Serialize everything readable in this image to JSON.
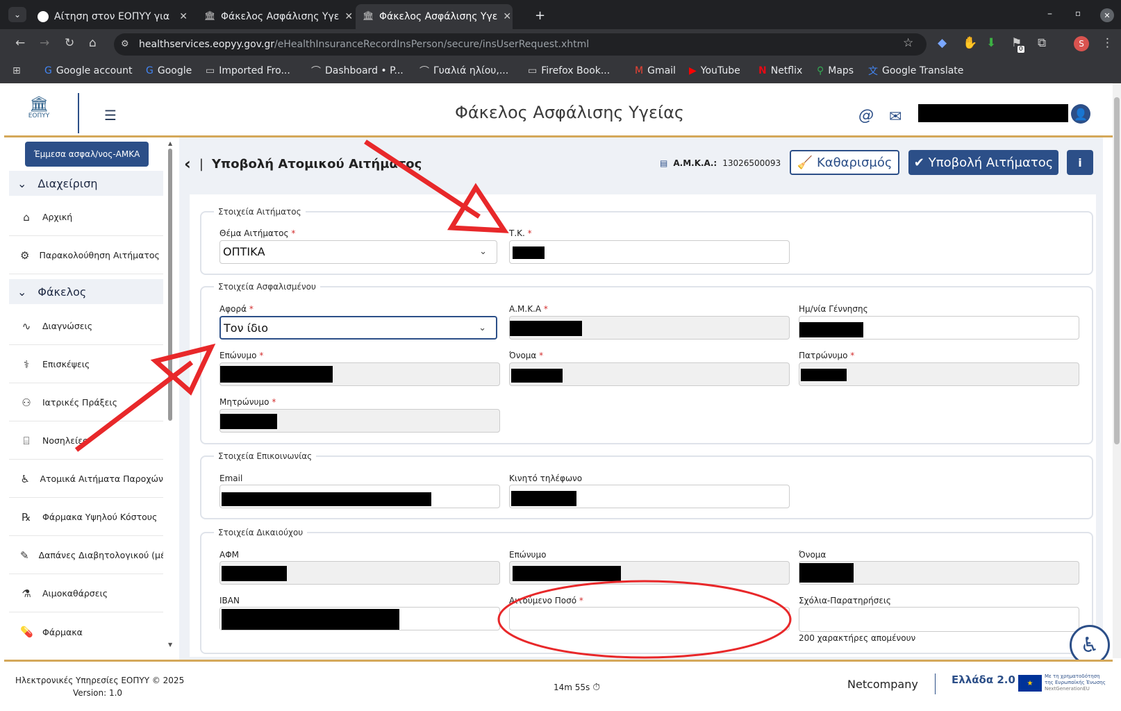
{
  "browser": {
    "tabs": [
      {
        "title": "Αίτηση στον ΕΟΠΥΥ για "
      },
      {
        "title": "Φάκελος Ασφάλισης Υγε"
      },
      {
        "title": "Φάκελος Ασφάλισης Υγε"
      }
    ],
    "url_host": "healthservices.eopyy.gov.gr",
    "url_path": "/eHealthInsuranceRecordInsPerson/secure/insUserRequest.xhtml",
    "profile_initial": "S",
    "extension_badge": "0",
    "bookmarks": [
      "Google account",
      "Google",
      "Imported Fro...",
      "Dashboard • P...",
      "Γυαλιά ηλίου,...",
      "Firefox Book...",
      "Gmail",
      "YouTube",
      "Netflix",
      "Maps",
      "Google Translate"
    ]
  },
  "app": {
    "logo_text": "ΕΟΠΥΥ",
    "title": "Φάκελος Ασφάλισης Υγείας"
  },
  "sidebar": {
    "amka_button": "Έμμεσα ασφαλ/νος-ΑΜΚΑ",
    "section1": "Διαχείριση",
    "section1_items": [
      "Αρχική",
      "Παρακολούθηση Αιτήματος Σ.Η."
    ],
    "section2": "Φάκελος",
    "section2_items": [
      "Διαγνώσεις",
      "Επισκέψεις",
      "Ιατρικές Πράξεις",
      "Νοσηλείες",
      "Ατομικά Αιτήματα Παροχών",
      "Φάρμακα Υψηλού Κόστους",
      "Δαπάνες Διαβητολογικού (μέχρι",
      "Αιμοκαθάρσεις",
      "Φάρμακα"
    ]
  },
  "main": {
    "back": "‹",
    "sep": "|",
    "page_title": "Υποβολή Ατομικού Αιτήματος",
    "amka_label": "Α.Μ.Κ.Α.:",
    "amka_value": "13026500093",
    "clear_button": "Καθαρισμός",
    "submit_button": "Υποβολή Αιτήματος",
    "info_button": "i"
  },
  "form": {
    "sec_request": "Στοιχεία Αιτήματος",
    "topic_label": "Θέμα Αιτήματος",
    "topic_value": "ΟΠΤΙΚΑ",
    "tk_label": "Τ.Κ.",
    "sec_insured": "Στοιχεία Ασφαλισμένου",
    "concerns_label": "Αφορά",
    "concerns_value": "Τον ίδιο",
    "amka_label": "Α.Μ.Κ.Α",
    "dob_label": "Ημ/νία Γέννησης",
    "surname_label": "Επώνυμο",
    "name_label": "Όνομα",
    "father_label": "Πατρώνυμο",
    "mother_label": "Μητρώνυμο",
    "sec_contact": "Στοιχεία Επικοινωνίας",
    "email_label": "Email",
    "mobile_label": "Κινητό τηλέφωνο",
    "sec_beneficiary": "Στοιχεία Δικαιούχου",
    "afm_label": "ΑΦΜ",
    "ben_surname_label": "Επώνυμο",
    "ben_name_label": "Όνομα",
    "iban_label": "IBAN",
    "amount_label": "Αιτούμενο Ποσό",
    "amount_label_visible": "Αιτούμενο Ποσό",
    "comments_label": "Σχόλια-Παρατηρήσεις",
    "chars_left": "200 χαρακτήρες απομένουν",
    "required_mark": "*"
  },
  "footer": {
    "copyright": "Ηλεκτρονικές Υπηρεσίες ΕΟΠΥΥ © 2025",
    "version": "Version: 1.0",
    "timer": "14m 55s",
    "vendor": "Netcompany",
    "greece": "Ελλάδα 2.0",
    "eu_text": "Με τη χρηματοδότηση της Ευρωπαϊκής Ένωσης",
    "eu_sub": "NextGenerationEU"
  },
  "colors": {
    "primary": "#2c4f88",
    "accent_gold": "#d4a85a",
    "annotation_red": "#e8282a"
  }
}
